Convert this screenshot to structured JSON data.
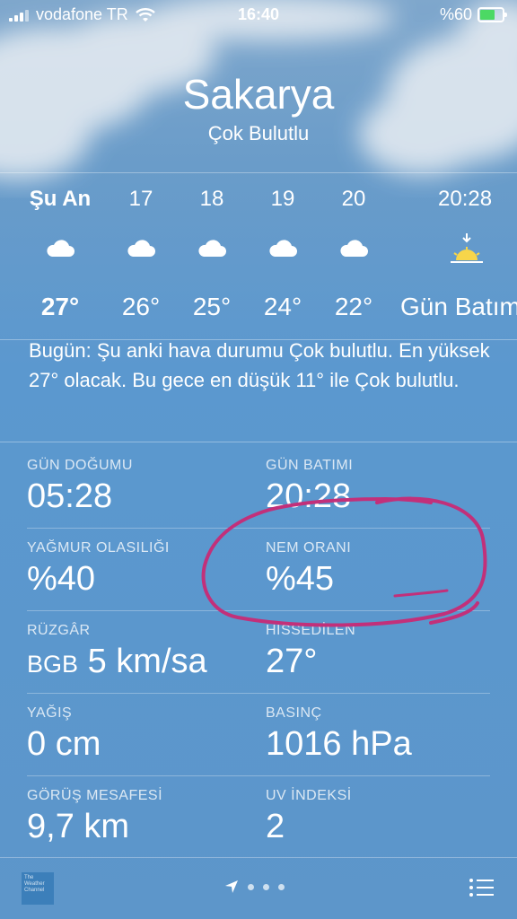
{
  "status_bar": {
    "carrier": "vodafone TR",
    "time": "16:40",
    "battery": "%60"
  },
  "header": {
    "city": "Sakarya",
    "condition": "Çok Bulutlu"
  },
  "hourly": [
    {
      "time": "Şu An",
      "icon": "cloud-icon",
      "temp": "27°"
    },
    {
      "time": "17",
      "icon": "cloud-icon",
      "temp": "26°"
    },
    {
      "time": "18",
      "icon": "cloud-icon",
      "temp": "25°"
    },
    {
      "time": "19",
      "icon": "cloud-icon",
      "temp": "24°"
    },
    {
      "time": "20",
      "icon": "cloud-icon",
      "temp": "22°"
    },
    {
      "time": "20:28",
      "icon": "sunset-icon",
      "temp": "Gün Batım"
    }
  ],
  "summary": "Bugün: Şu anki hava durumu Çok bulutlu. En yüksek 27° olacak. Bu gece en düşük 11° ile Çok bulutlu.",
  "details": {
    "sunrise": {
      "label": "GÜN DOĞUMU",
      "value": "05:28"
    },
    "sunset": {
      "label": "GÜN BATIMI",
      "value": "20:28"
    },
    "rain_chance": {
      "label": "YAĞMUR OLASILIĞI",
      "value": "%40"
    },
    "humidity": {
      "label": "NEM ORANI",
      "value": "%45"
    },
    "wind": {
      "label": "RÜZGÂR",
      "direction": "BGB",
      "value": "5 km/sa"
    },
    "feels_like": {
      "label": "HİSSEDİLEN",
      "value": "27°"
    },
    "precipitation": {
      "label": "YAĞIŞ",
      "value": "0 cm"
    },
    "pressure": {
      "label": "BASINÇ",
      "value": "1016 hPa"
    },
    "visibility": {
      "label": "GÖRÜŞ MESAFESİ",
      "value": "9,7 km"
    },
    "uv_index": {
      "label": "UV İNDEKSİ",
      "value": "2"
    }
  },
  "bottom_bar": {
    "logo_text": "The Weather Channel"
  },
  "colors": {
    "background": "#5b98cf",
    "annotation": "#c2307a"
  }
}
